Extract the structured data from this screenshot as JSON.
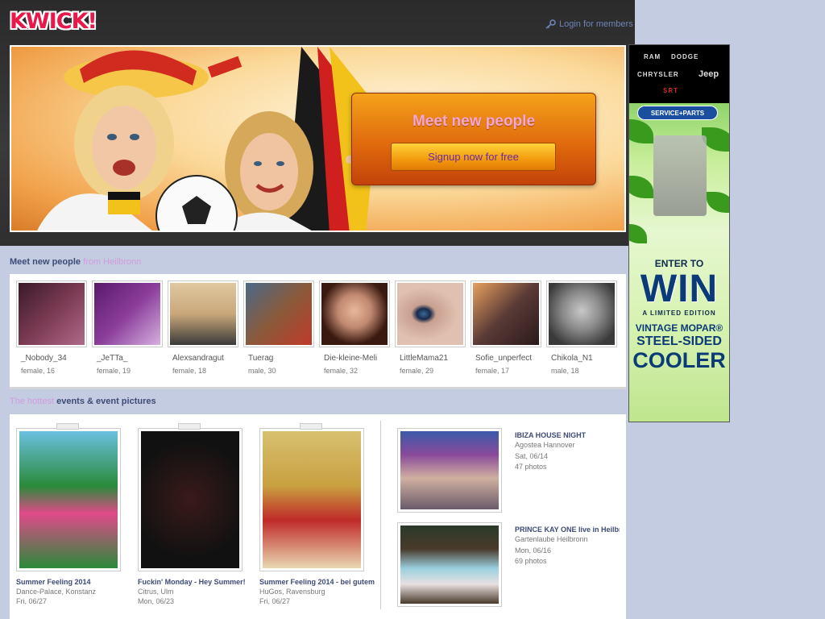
{
  "header": {
    "logo": "KWICK!",
    "login_link": "Login for members"
  },
  "hero": {
    "headline": "Meet new people",
    "signup_button": "Signup now for free"
  },
  "ad": {
    "brands": [
      "RAM",
      "DODGE",
      "CHRYSLER",
      "Jeep",
      "SRT"
    ],
    "badge": "SERVICE+PARTS",
    "enter": "ENTER TO",
    "win": "WIN",
    "limited": "A LIMITED EDITION",
    "vintage": "VINTAGE MOPAR®",
    "steel": "STEEL-SIDED",
    "cooler": "COOLER"
  },
  "people_section": {
    "heading": "Meet new people",
    "location": "from Heilbronn",
    "people": [
      {
        "name": "_Nobody_34",
        "meta": "female, 16",
        "color": "#7a3a52"
      },
      {
        "name": "_JeTTa_",
        "meta": "female, 19",
        "color": "#8a3d9a"
      },
      {
        "name": "Alexsandragut",
        "meta": "female, 18",
        "color": "#c9a77a"
      },
      {
        "name": "Tuerag",
        "meta": "male, 30",
        "color": "#8a5a3a"
      },
      {
        "name": "Die-kleine-Meli",
        "meta": "female, 32",
        "color": "#6b3a2a"
      },
      {
        "name": "LittleMama21",
        "meta": "female, 29",
        "color": "#c8a090"
      },
      {
        "name": "Sofie_unperfect",
        "meta": "female, 17",
        "color": "#5a3a36"
      },
      {
        "name": "Chikola_N1",
        "meta": "male, 18",
        "color": "#7a7a7a"
      }
    ]
  },
  "events_section": {
    "heading_pale": "The hottest",
    "heading": "events & event pictures",
    "posters": [
      {
        "title": "Summer Feeling 2014",
        "venue": "Dance-Palace, Konstanz",
        "date": "Fri, 06/27",
        "color": "#2a8a3a"
      },
      {
        "title": "Fuckin' Monday - Hey Summer!",
        "venue": "Citrus, Ulm",
        "date": "Mon, 06/23",
        "color": "#1a1a1a"
      },
      {
        "title": "Summer Feeling 2014 - bei gutem",
        "venue": "HuGos, Ravensburg",
        "date": "Fri, 06/27",
        "color": "#c8a040"
      }
    ],
    "photo_events": [
      {
        "title": "IBIZA HOUSE NIGHT",
        "venue": "Agostea Hannover",
        "date": "Sat, 06/14",
        "photos": "47 photos",
        "color": "#6a4a7a"
      },
      {
        "title": "PRINCE KAY ONE live in Heilbronn",
        "venue": "Gartenlaube Heilbronn",
        "date": "Mon, 06/16",
        "photos": "69 photos",
        "color": "#4a3a2a"
      }
    ]
  }
}
